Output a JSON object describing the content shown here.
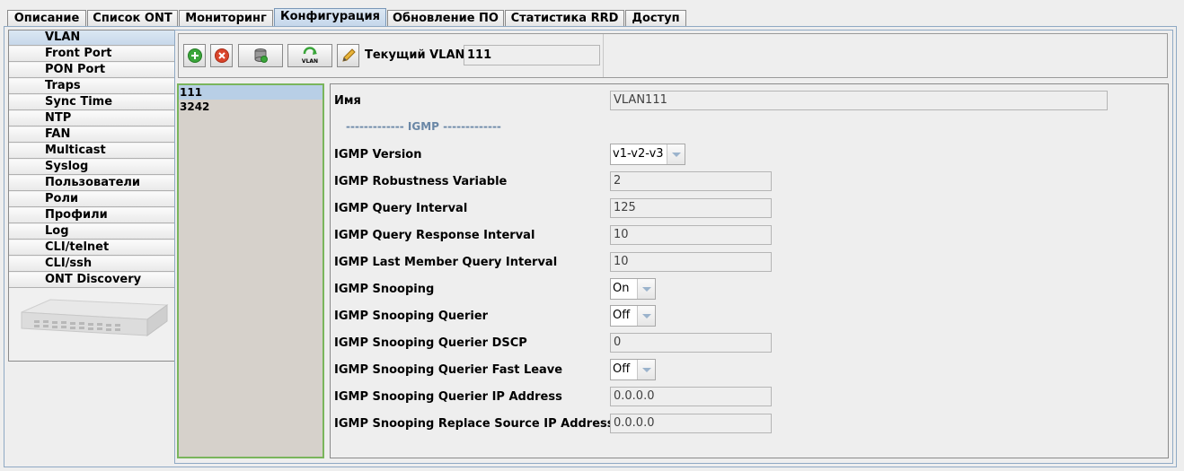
{
  "tabs": [
    {
      "label": "Описание",
      "active": false
    },
    {
      "label": "Список ONT",
      "active": false
    },
    {
      "label": "Мониторинг",
      "active": false
    },
    {
      "label": "Конфигурация",
      "active": true
    },
    {
      "label": "Обновление ПО",
      "active": false
    },
    {
      "label": "Статистика RRD",
      "active": false
    },
    {
      "label": "Доступ",
      "active": false
    }
  ],
  "sidebar": {
    "items": [
      {
        "label": "VLAN",
        "active": true
      },
      {
        "label": "Front Port"
      },
      {
        "label": "PON Port"
      },
      {
        "label": "Traps"
      },
      {
        "label": "Sync Time"
      },
      {
        "label": "NTP"
      },
      {
        "label": "FAN"
      },
      {
        "label": "Multicast"
      },
      {
        "label": "Syslog"
      },
      {
        "label": "Пользователи"
      },
      {
        "label": "Роли"
      },
      {
        "label": "Профили"
      },
      {
        "label": "Log"
      },
      {
        "label": "CLI/telnet"
      },
      {
        "label": "CLI/ssh"
      },
      {
        "label": "ONT Discovery"
      }
    ],
    "device_icon": "olt-device-image"
  },
  "toolbar": {
    "buttons": [
      {
        "name": "add-button",
        "icon": "plus-circle-icon",
        "color": "#3aa53a"
      },
      {
        "name": "delete-button",
        "icon": "x-circle-icon",
        "color": "#d9452b"
      },
      {
        "name": "save-db-button",
        "icon": "database-icon"
      },
      {
        "name": "refresh-vlan-button",
        "icon": "vlan-refresh-icon",
        "text": "VLAN"
      },
      {
        "name": "edit-button",
        "icon": "pencil-icon"
      }
    ],
    "current_vlan_label": "Текущий VLAN:",
    "current_vlan_value": "111"
  },
  "vlan_list": [
    "111",
    "3242"
  ],
  "form": {
    "name_label": "Имя",
    "name_value": "VLAN111",
    "separator": "------------- IGMP -------------",
    "fields": [
      {
        "label": "IGMP Version",
        "value": "v1-v2-v3",
        "type": "select"
      },
      {
        "label": "IGMP Robustness Variable",
        "value": "2",
        "type": "text"
      },
      {
        "label": "IGMP Query Interval",
        "value": "125",
        "type": "text"
      },
      {
        "label": "IGMP Query Response Interval",
        "value": "10",
        "type": "text"
      },
      {
        "label": "IGMP Last Member Query Interval",
        "value": "10",
        "type": "text"
      },
      {
        "label": "IGMP Snooping",
        "value": "On",
        "type": "select"
      },
      {
        "label": "IGMP Snooping Querier",
        "value": "Off",
        "type": "select"
      },
      {
        "label": "IGMP Snooping Querier DSCP",
        "value": "0",
        "type": "text"
      },
      {
        "label": "IGMP Snooping Querier Fast Leave",
        "value": "Off",
        "type": "select"
      },
      {
        "label": "IGMP Snooping Querier IP Address",
        "value": "0.0.0.0",
        "type": "text"
      },
      {
        "label": "IGMP Snooping Replace Source IP Address",
        "value": "0.0.0.0",
        "type": "text"
      }
    ]
  },
  "colors": {
    "accent": "#c4d6ea",
    "list_border": "#7ab55c",
    "separator": "#6a87a6"
  }
}
